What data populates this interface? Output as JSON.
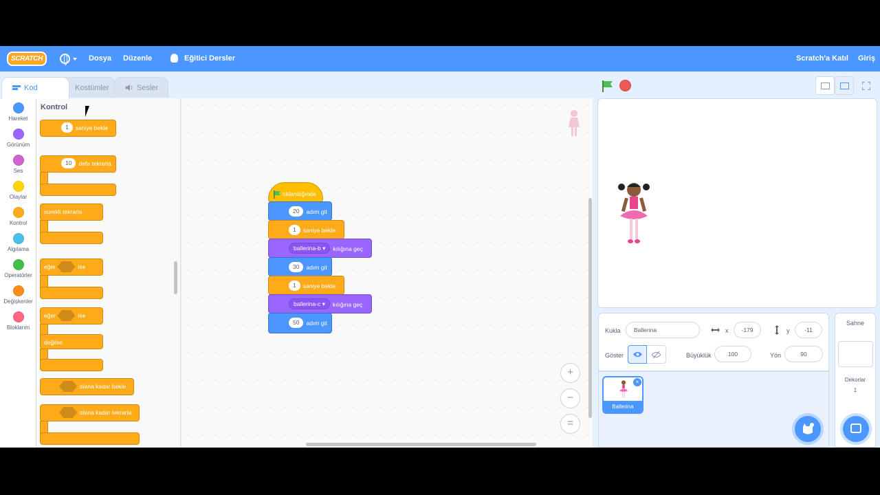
{
  "menubar": {
    "logo": "SCRATCH",
    "file": "Dosya",
    "edit": "Düzenle",
    "tutorials": "Eğitici Dersler",
    "join": "Scratch'a Katıl",
    "signin": "Giriş"
  },
  "tabs": {
    "code": "Kod",
    "costumes": "Kostümler",
    "sounds": "Sesler"
  },
  "categories": [
    {
      "label": "Hareket",
      "color": "#4c97ff"
    },
    {
      "label": "Görünüm",
      "color": "#9966ff"
    },
    {
      "label": "Ses",
      "color": "#cf63cf"
    },
    {
      "label": "Olaylar",
      "color": "#ffd500"
    },
    {
      "label": "Kontrol",
      "color": "#ffab19"
    },
    {
      "label": "Algılama",
      "color": "#4cbfe6"
    },
    {
      "label": "Operatörler",
      "color": "#40bf4a"
    },
    {
      "label": "Değişkenler",
      "color": "#ff8c1a"
    },
    {
      "label": "Bloklarım",
      "color": "#ff6680"
    }
  ],
  "palette": {
    "title": "Kontrol",
    "wait_num": "1",
    "wait": "saniye bekle",
    "repeat_num": "10",
    "repeat": "defa tekrarla",
    "forever": "sürekli tekrarla",
    "if": "eğer",
    "then": "ise",
    "if2": "eğer",
    "then2": "ise",
    "else": "değilse",
    "wait_until": "olana kadar bekle",
    "repeat_until": "olana kadar tekrarla"
  },
  "script": {
    "hat": "tıklandığında",
    "b1_num": "20",
    "b1": "adım git",
    "b2_num": "1",
    "b2": "saniye bekle",
    "b3_dd": "ballerina-b",
    "b3": "kılığına geç",
    "b4_num": "30",
    "b4": "adım git",
    "b5_num": "1",
    "b5": "saniye bekle",
    "b6_dd": "ballerina-c",
    "b6": "kılığına geç",
    "b7_num": "50",
    "b7": "adım git"
  },
  "sprite_info": {
    "sprite_label": "Kukla",
    "sprite_name": "Ballerina",
    "x_label": "x",
    "x_value": "-179",
    "y_label": "y",
    "y_value": "-11",
    "show_label": "Göster",
    "size_label": "Büyüklük",
    "size_value": "100",
    "direction_label": "Yön",
    "direction_value": "90"
  },
  "sprite_list": {
    "name": "Ballerina"
  },
  "stage_panel": {
    "title": "Sahne",
    "backdrops_label": "Dekorlar",
    "backdrops_count": "1"
  }
}
